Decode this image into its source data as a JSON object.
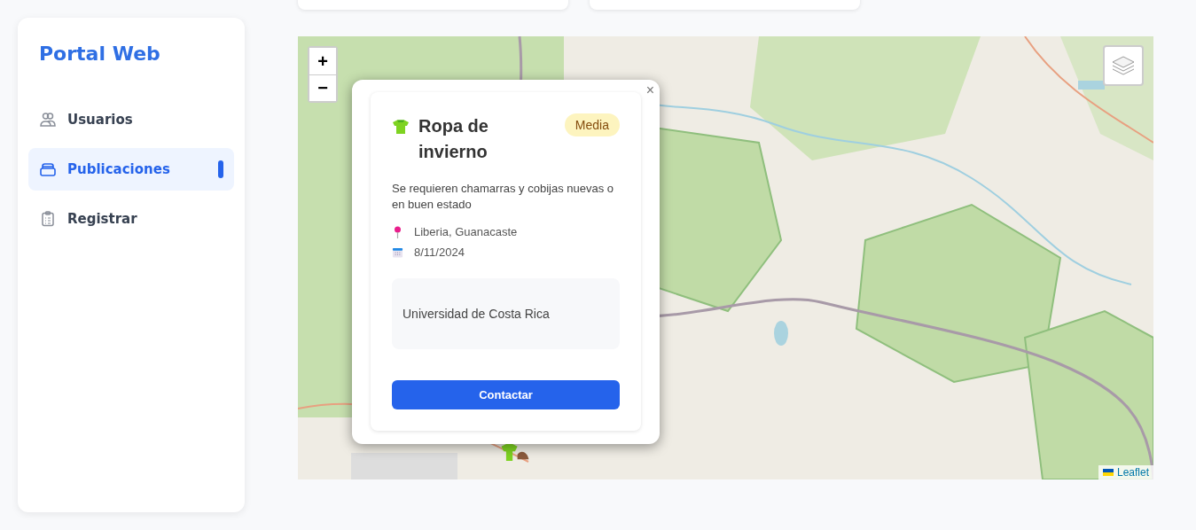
{
  "sidebar": {
    "brand": "Portal Web",
    "items": [
      {
        "label": "Usuarios",
        "kind": "users",
        "selected": false
      },
      {
        "label": "Publicaciones",
        "kind": "tray",
        "selected": true
      },
      {
        "label": "Registrar",
        "kind": "clipboard",
        "selected": false
      }
    ]
  },
  "map": {
    "zoom_in": "+",
    "zoom_out": "−",
    "attribution": "Leaflet",
    "popup": {
      "close": "×",
      "title": "Ropa de invierno",
      "badge": "Media",
      "description": "Se requieren chamarras y cobijas nuevas o en buen estado",
      "location": "Liberia, Guanacaste",
      "date": "8/11/2024",
      "organization": "Universidad de Costa Rica",
      "button": "Contactar"
    }
  }
}
